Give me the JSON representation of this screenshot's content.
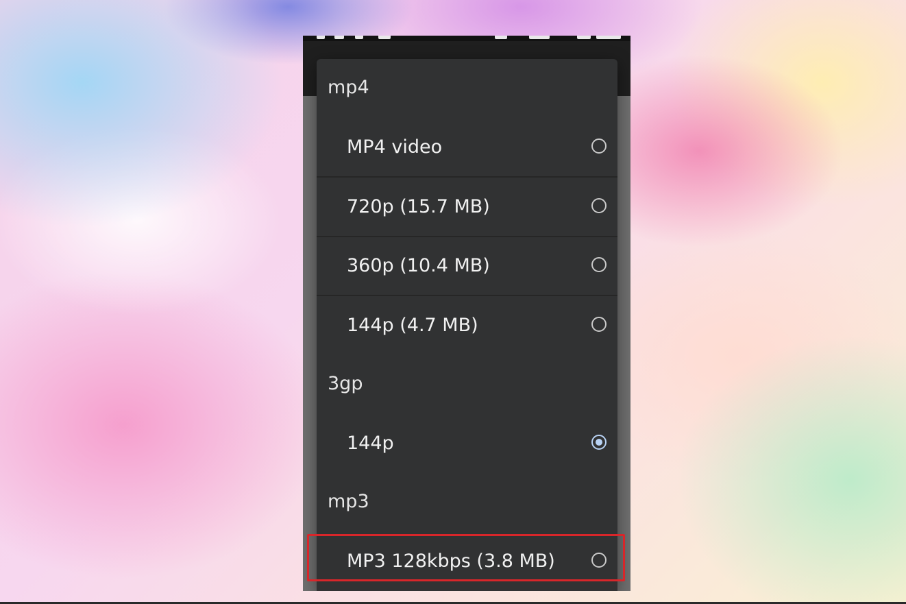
{
  "dialog": {
    "groups": [
      {
        "header": "mp4",
        "options": [
          {
            "label": "MP4 video",
            "selected": false
          },
          {
            "label": "720p (15.7 MB)",
            "selected": false
          },
          {
            "label": "360p (10.4 MB)",
            "selected": false
          },
          {
            "label": "144p (4.7 MB)",
            "selected": false
          }
        ]
      },
      {
        "header": "3gp",
        "options": [
          {
            "label": "144p",
            "selected": true
          }
        ]
      },
      {
        "header": "mp3",
        "options": [
          {
            "label": "MP3 128kbps (3.8 MB)",
            "selected": false,
            "highlighted": true
          }
        ]
      }
    ]
  },
  "colors": {
    "dialog_bg": "#313233",
    "radio_selected": "#b9d3f5",
    "highlight": "#d8262a"
  }
}
